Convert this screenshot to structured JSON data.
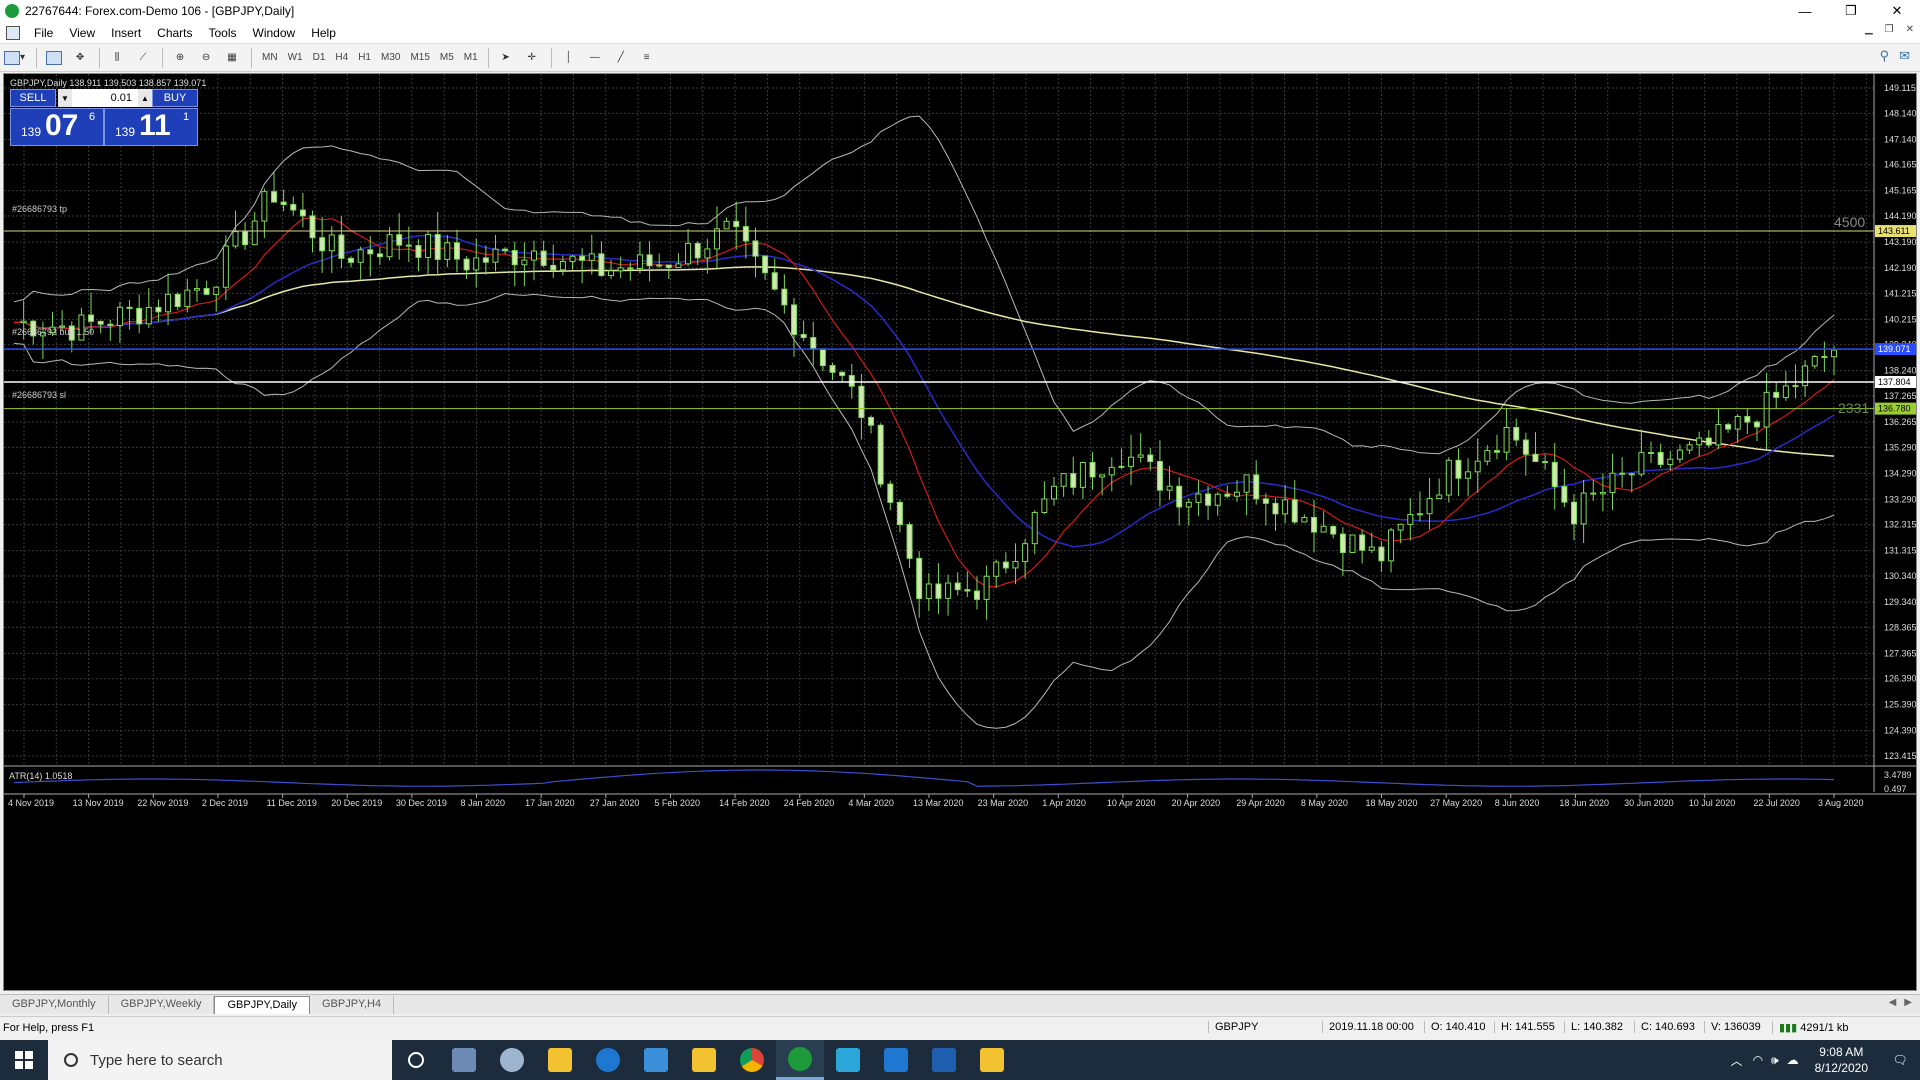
{
  "window": {
    "title": "22767644: Forex.com-Demo 106 - [GBPJPY,Daily]",
    "minimize": "—",
    "maximize": "❐",
    "close": "✕"
  },
  "menu": [
    "File",
    "View",
    "Insert",
    "Charts",
    "Tools",
    "Window",
    "Help"
  ],
  "toolbar": {
    "timeframes": [
      "MN",
      "W1",
      "D1",
      "H4",
      "H1",
      "M30",
      "M15",
      "M5",
      "M1"
    ]
  },
  "chart": {
    "symbol_label": "GBPJPY,Daily  138.911 139.503 138.857 139.071",
    "sell_label": "SELL",
    "buy_label": "BUY",
    "lot_value": "0.01",
    "sell_price_small": "139",
    "sell_price_big": "07",
    "sell_price_sup": "6",
    "buy_price_small": "139",
    "buy_price_big": "11",
    "buy_price_sup": "1",
    "tp_label": "#26686793 tp",
    "buy_line_label": "#26686793 buy 1.50",
    "sl_label": "#26686793 sl",
    "tp_distance": "4500",
    "sl_distance": "2331",
    "atr_label": "ATR(14) 1.0518",
    "price_axis": [
      "149.115",
      "148.140",
      "147.140",
      "146.165",
      "145.165",
      "144.190",
      "143.190",
      "142.190",
      "141.215",
      "140.215",
      "139.240",
      "138.240",
      "137.265",
      "136.265",
      "135.290",
      "134.290",
      "133.290",
      "132.315",
      "131.315",
      "130.340",
      "129.340",
      "128.365",
      "127.365",
      "126.390",
      "125.390",
      "124.390",
      "123.415"
    ],
    "tp_price_tag": "143.611",
    "buy_price_tag": "139.071",
    "white_price_tag": "137.804",
    "sl_price_tag": "136.780",
    "atr_axis": [
      "3.4789",
      "0.497"
    ],
    "date_axis": [
      "4 Nov 2019",
      "13 Nov 2019",
      "22 Nov 2019",
      "2 Dec 2019",
      "11 Dec 2019",
      "20 Dec 2019",
      "30 Dec 2019",
      "8 Jan 2020",
      "17 Jan 2020",
      "27 Jan 2020",
      "5 Feb 2020",
      "14 Feb 2020",
      "24 Feb 2020",
      "4 Mar 2020",
      "13 Mar 2020",
      "23 Mar 2020",
      "1 Apr 2020",
      "10 Apr 2020",
      "20 Apr 2020",
      "29 Apr 2020",
      "8 May 2020",
      "18 May 2020",
      "27 May 2020",
      "8 Jun 2020",
      "18 Jun 2020",
      "30 Jun 2020",
      "10 Jul 2020",
      "22 Jul 2020",
      "3 Aug 2020"
    ],
    "colors": {
      "background": "#000000",
      "grid": "#3a3a3a",
      "bull_candle": "#7ed957",
      "bear_candle": "#cfe8b0",
      "ma_fast": "#d11a1a",
      "ma_slow": "#2a2ac8",
      "bollinger": "#b8b8b8",
      "ma_long": "#e8e6a8",
      "tp_line": "#d6d48a",
      "buy_line": "#2a4cff",
      "sl_line": "#9acd32",
      "atr": "#3b4fd0"
    }
  },
  "tabs": [
    "GBPJPY,Monthly",
    "GBPJPY,Weekly",
    "GBPJPY,Daily",
    "GBPJPY,H4"
  ],
  "active_tab": "GBPJPY,Daily",
  "status": {
    "help": "For Help, press F1",
    "symbol": "GBPJPY",
    "datetime": "2019.11.18 00:00",
    "open": "O: 140.410",
    "high": "H: 141.555",
    "low": "L: 140.382",
    "close": "C: 140.693",
    "volume": "V: 136039",
    "traffic": "4291/1 kb"
  },
  "taskbar": {
    "search_placeholder": "Type here to search",
    "time": "9:08 AM",
    "date": "8/12/2020"
  },
  "chart_data": {
    "type": "candlestick",
    "title": "GBPJPY,Daily",
    "ylim": [
      123.415,
      149.115
    ],
    "x": [
      "4 Nov 2019",
      "13 Nov 2019",
      "22 Nov 2019",
      "2 Dec 2019",
      "11 Dec 2019",
      "20 Dec 2019",
      "30 Dec 2019",
      "8 Jan 2020",
      "17 Jan 2020",
      "27 Jan 2020",
      "5 Feb 2020",
      "14 Feb 2020",
      "24 Feb 2020",
      "4 Mar 2020",
      "13 Mar 2020",
      "23 Mar 2020",
      "1 Apr 2020",
      "10 Apr 2020",
      "20 Apr 2020",
      "29 Apr 2020",
      "8 May 2020",
      "18 May 2020",
      "27 May 2020",
      "8 Jun 2020",
      "18 Jun 2020",
      "30 Jun 2020",
      "10 Jul 2020",
      "22 Jul 2020",
      "3 Aug 2020"
    ],
    "close_approx": [
      140.1,
      139.9,
      140.6,
      141.6,
      145.1,
      142.6,
      143.3,
      142.4,
      142.9,
      142.1,
      142.4,
      143.6,
      140.2,
      137.0,
      129.4,
      130.0,
      133.6,
      135.2,
      133.4,
      133.9,
      132.5,
      131.0,
      134.2,
      136.0,
      132.8,
      134.5,
      135.2,
      136.9,
      139.1
    ],
    "levels": {
      "tp": 143.611,
      "entry": 139.071,
      "sl": 136.78,
      "line": 137.804
    },
    "grid": true
  }
}
